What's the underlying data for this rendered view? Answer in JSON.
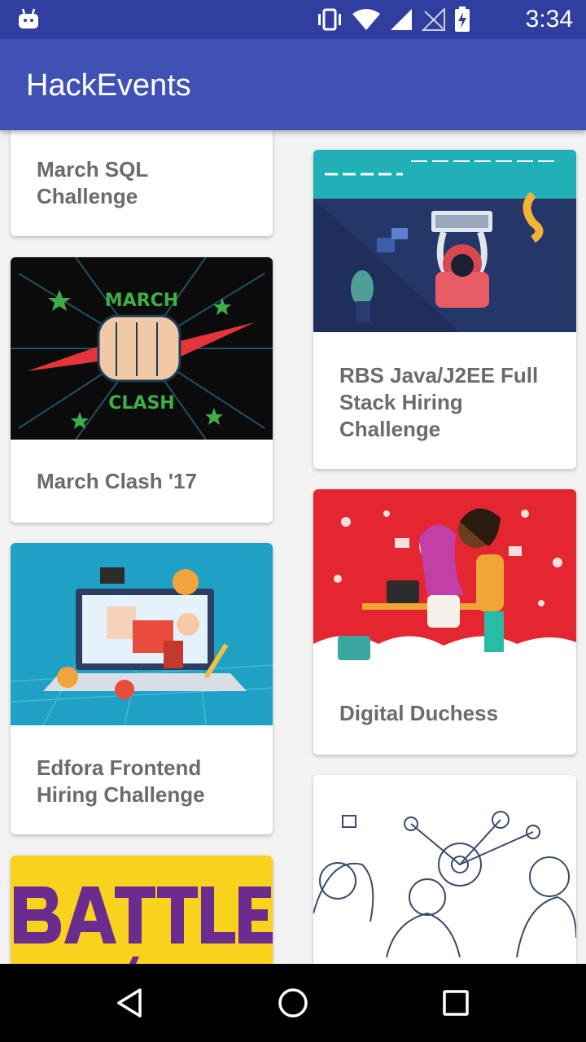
{
  "status_bar": {
    "time": "3:34",
    "icons": [
      "android-icon",
      "vibrate-icon",
      "wifi-icon",
      "signal-icon",
      "signal-empty-icon",
      "battery-charging-icon"
    ]
  },
  "app_bar": {
    "title": "HackEvents"
  },
  "events": [
    {
      "title": "March SQL Challenge",
      "image": null
    },
    {
      "title": "RBS Java/J2EE Full Stack Hiring Challenge",
      "image": "coder-at-desk"
    },
    {
      "title": "March Clash '17",
      "image": "march-clash-fist"
    },
    {
      "title": "Digital Duchess",
      "image": "digital-duchess-illustration"
    },
    {
      "title": "Edfora Frontend Hiring Challenge",
      "image": "edfora-laptop"
    },
    {
      "title": "",
      "image": "doodle-people"
    },
    {
      "title": "",
      "image": "battle-the-bots"
    }
  ],
  "nav_bar": {
    "buttons": [
      "back-icon",
      "home-icon",
      "recents-icon"
    ]
  },
  "colors": {
    "status_bar": "#303f9f",
    "app_bar": "#3f51b5",
    "background": "#f2f2f2",
    "card_title": "#6b6b6b"
  }
}
